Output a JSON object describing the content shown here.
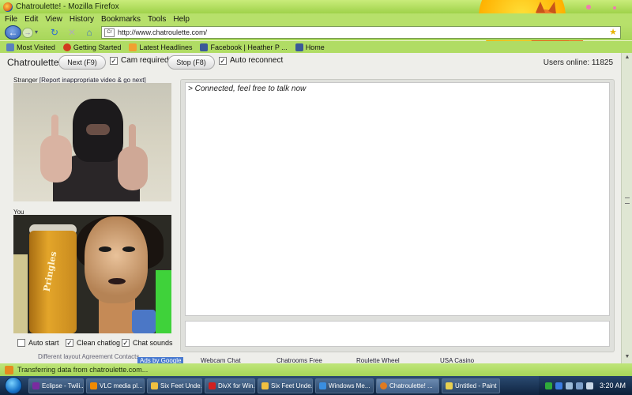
{
  "window": {
    "title": "Chatroulette! - Mozilla Firefox"
  },
  "menu": [
    "File",
    "Edit",
    "View",
    "History",
    "Bookmarks",
    "Tools",
    "Help"
  ],
  "address": {
    "url": "http://www.chatroulette.com/",
    "favicon_text": "Cr"
  },
  "bookmarks": [
    {
      "label": "Most Visited",
      "icon_color": "#5a7fc0"
    },
    {
      "label": "Getting Started",
      "icon_color": "#d23b1f"
    },
    {
      "label": "Latest Headlines",
      "icon_color": "#f0a030"
    },
    {
      "label": "Facebook | Heather P ...",
      "icon_color": "#3b5998"
    },
    {
      "label": "Home",
      "icon_color": "#3b5998"
    }
  ],
  "app": {
    "brand": "Chatroulette",
    "next_button": "Next (F9)",
    "cam_required": "Cam required",
    "stop_button": "Stop (F8)",
    "auto_reconnect": "Auto reconnect",
    "users_online": "Users online: 11825"
  },
  "stranger": {
    "label": "Stranger",
    "report_link": "[Report inappropriate video & go next]"
  },
  "you": {
    "label": "You",
    "can_brand": "Pringles"
  },
  "options": {
    "auto_start": "Auto start",
    "clean_chatlog": "Clean chatlog",
    "chat_sounds": "Chat sounds",
    "auto_start_checked": false,
    "clean_chatlog_checked": true,
    "chat_sounds_checked": true
  },
  "links_row": "Different layout     Agreement     Contacts",
  "chat": {
    "message": "> Connected, feel free to talk now"
  },
  "ads": {
    "ads_by": "Ads by Google",
    "links": [
      "Webcam Chat",
      "Chatrooms Free",
      "Roulette Wheel",
      "USA Casino"
    ]
  },
  "status": {
    "text": "Transferring data from chatroulette.com..."
  },
  "taskbar": {
    "items": [
      {
        "label": "Eclipse - Twili...",
        "icon_color": "#7a2ba0"
      },
      {
        "label": "VLC media pl...",
        "icon_color": "#f08a00"
      },
      {
        "label": "Six Feet Unde...",
        "icon_color": "#f0c040"
      },
      {
        "label": "DivX for Win...",
        "icon_color": "#d02020"
      },
      {
        "label": "Six Feet Unde...",
        "icon_color": "#f0c040"
      },
      {
        "label": "Windows Me...",
        "icon_color": "#3a8ee0"
      },
      {
        "label": "Chatroulette! ...",
        "icon_color": "#e07a20",
        "active": true
      },
      {
        "label": "Untitled - Paint",
        "icon_color": "#e8d050"
      }
    ],
    "clock": "3:20 AM"
  }
}
